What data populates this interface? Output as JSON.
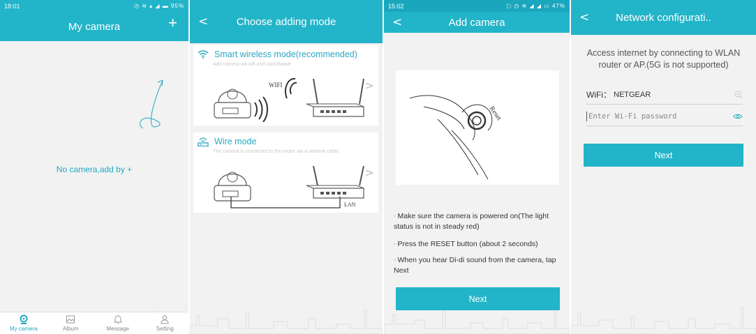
{
  "screen1": {
    "status_time": "18:01",
    "status_battery": "95%",
    "title": "My camera",
    "add_symbol": "+",
    "empty_message": "No camera,add by +",
    "tabs": [
      {
        "label": "My camera",
        "icon": "camera-pin-icon",
        "active": true
      },
      {
        "label": "Album",
        "icon": "image-icon",
        "active": false
      },
      {
        "label": "Message",
        "icon": "bell-icon",
        "active": false
      },
      {
        "label": "Setting",
        "icon": "person-icon",
        "active": false
      }
    ]
  },
  "screen2": {
    "back_symbol": "<",
    "title": "Choose adding mode",
    "modes": [
      {
        "title": "Smart wireless mode(recommended)",
        "description": "Add camera via wifi and soundwave",
        "icon": "wifi-icon",
        "figure_label": "WIFI"
      },
      {
        "title": "Wire mode",
        "description": "The camera is connected to the router via a network cable",
        "icon": "router-icon",
        "figure_label": "LAN"
      }
    ],
    "chevron": ">"
  },
  "screen3": {
    "status_time": "15:02",
    "status_battery": "47%",
    "back_symbol": "<",
    "title": "Add camera",
    "illustration_label": "Reset",
    "steps": [
      "Make sure the camera is powered on(The light status is not in steady red)",
      "Press the RESET button (about 2 seconds)",
      "When you hear Di-di sound from the camera, tap Next"
    ],
    "next_label": "Next"
  },
  "screen4": {
    "back_symbol": "<",
    "title": "Network configurati..",
    "info": "Access internet by connecting to WLAN router or AP.(5G is not supported)",
    "wifi_label": "WiFi：",
    "wifi_value": "NETGEAR",
    "password_placeholder": "Enter Wi-Fi password",
    "next_label": "Next"
  },
  "colors": {
    "accent": "#22b4c8",
    "link": "#22a8c4",
    "bullet": "#f39a4a",
    "background": "#f2f2f2"
  }
}
